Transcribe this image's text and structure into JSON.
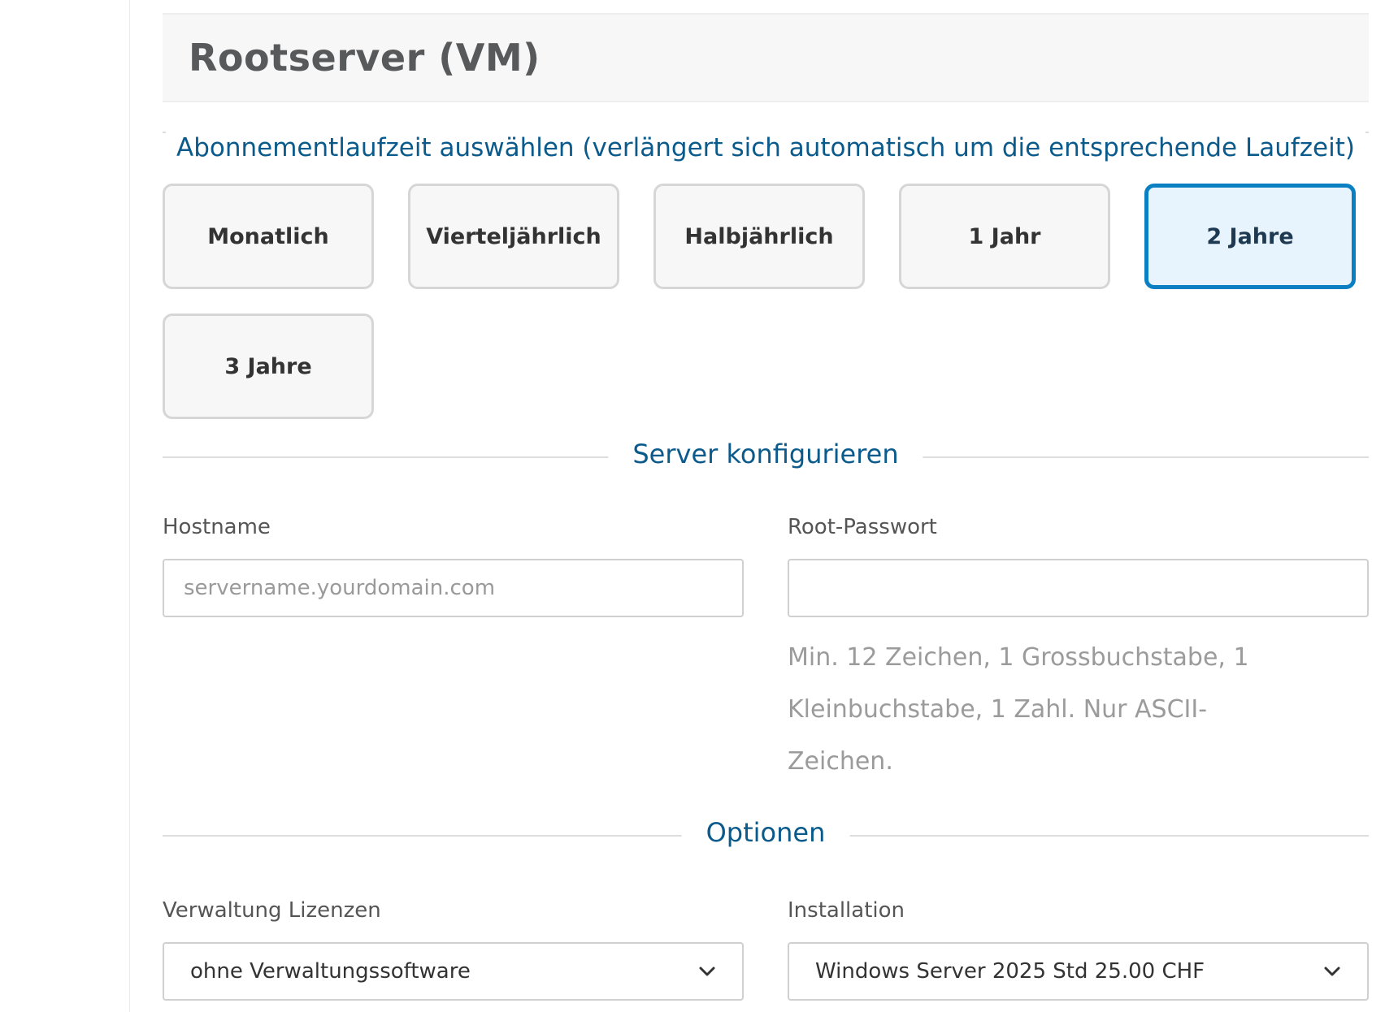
{
  "product": {
    "title": "Rootserver (VM)"
  },
  "billing": {
    "heading": "Abonnementlaufzeit auswählen (verlängert sich automatisch um die entsprechende Laufzeit)",
    "options": [
      {
        "label": "Monatlich",
        "selected": false
      },
      {
        "label": "Vierteljährlich",
        "selected": false
      },
      {
        "label": "Halbjährlich",
        "selected": false
      },
      {
        "label": "1 Jahr",
        "selected": false
      },
      {
        "label": "2 Jahre",
        "selected": true
      },
      {
        "label": "3 Jahre",
        "selected": false
      }
    ]
  },
  "server_config": {
    "heading": "Server konfigurieren",
    "hostname": {
      "label": "Hostname",
      "value": "",
      "placeholder": "servername.yourdomain.com"
    },
    "root_password": {
      "label": "Root-Passwort",
      "value": "",
      "placeholder": "",
      "hint": "Min. 12 Zeichen, 1 Grossbuchstabe, 1 Kleinbuchstabe, 1 Zahl. Nur ASCII-Zeichen."
    }
  },
  "options": {
    "heading": "Optionen",
    "license_management": {
      "label": "Verwaltung Lizenzen",
      "selected": "ohne Verwaltungssoftware"
    },
    "installation": {
      "label": "Installation",
      "selected": "Windows Server 2025 Std 25.00 CHF"
    }
  },
  "colors": {
    "accent": "#0a7fc2",
    "heading": "#0b5a8c",
    "selected_bg": "#e8f4fd"
  }
}
